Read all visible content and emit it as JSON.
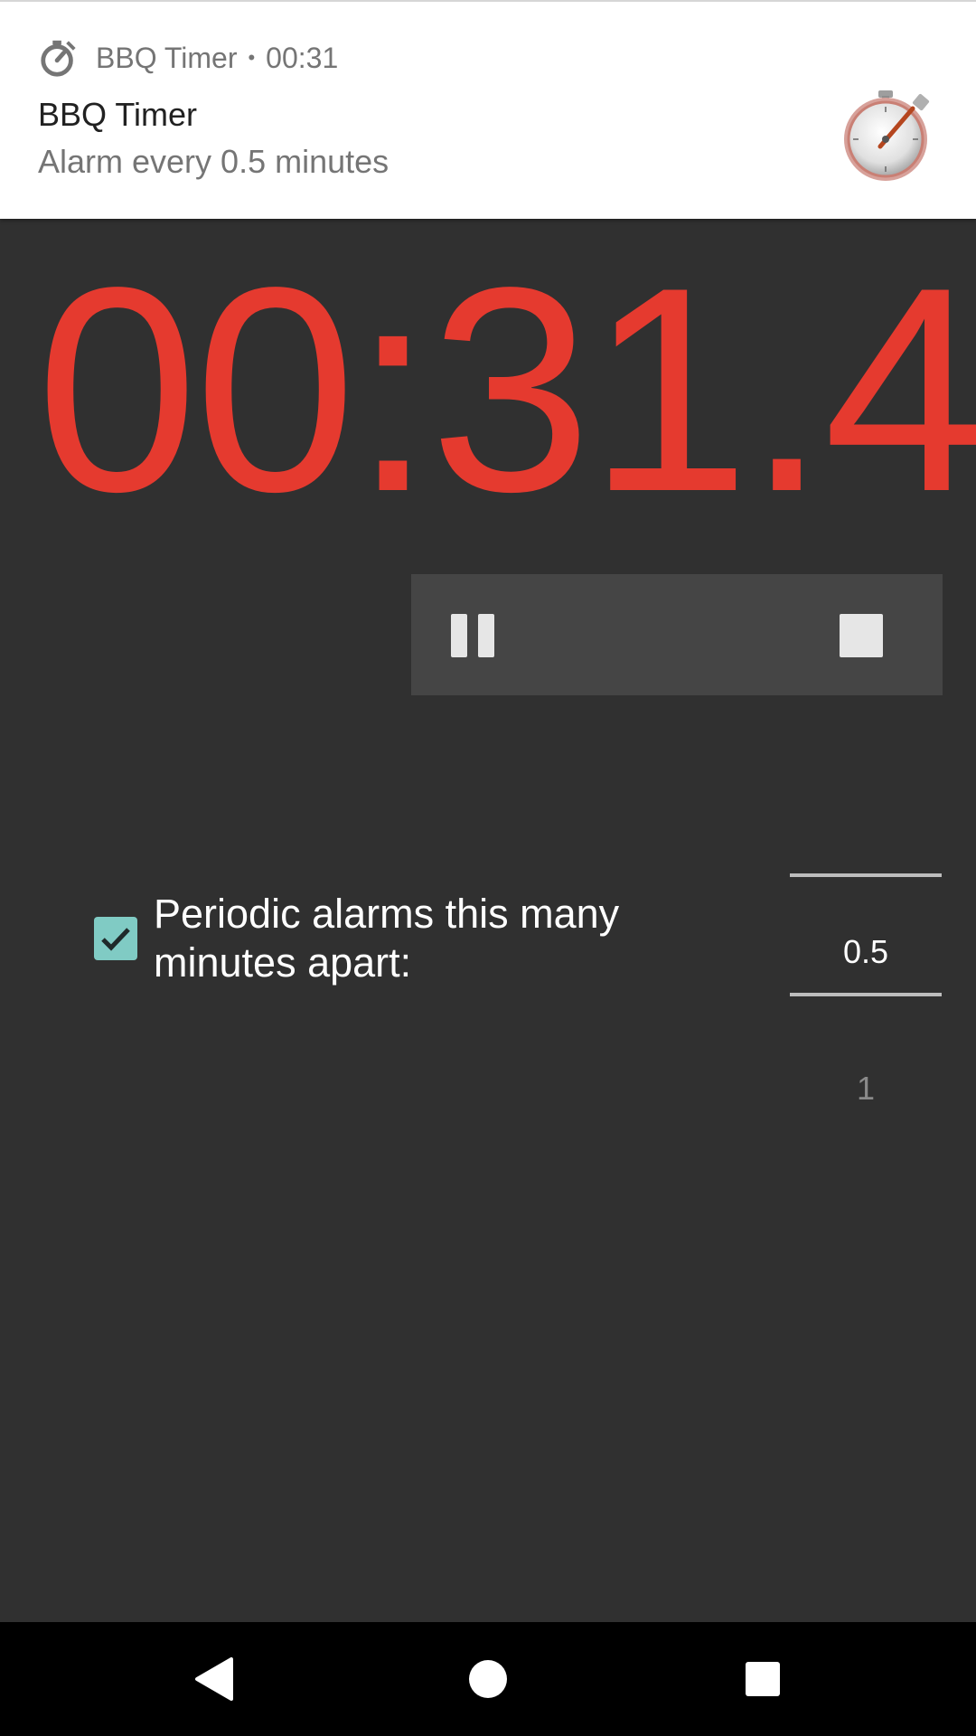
{
  "notification": {
    "app_name": "BBQ Timer",
    "separator": "•",
    "time": "00:31",
    "title": "BBQ Timer",
    "text": "Alarm every 0.5 minutes"
  },
  "timer": {
    "display": "00:31.4"
  },
  "controls": {
    "pause_icon": "pause-icon",
    "stop_icon": "stop-icon"
  },
  "periodic": {
    "checked": true,
    "label": "Periodic alarms this many minutes apart:",
    "picker_selected": "0.5",
    "picker_next": "1"
  },
  "navigation": {
    "back_icon": "back-triangle-icon",
    "home_icon": "home-circle-icon",
    "recents_icon": "recents-square-icon"
  },
  "colors": {
    "background": "#303030",
    "timer_red": "#e53a2f",
    "controls_bg": "#454545",
    "checkbox_teal": "#80cbc4"
  }
}
